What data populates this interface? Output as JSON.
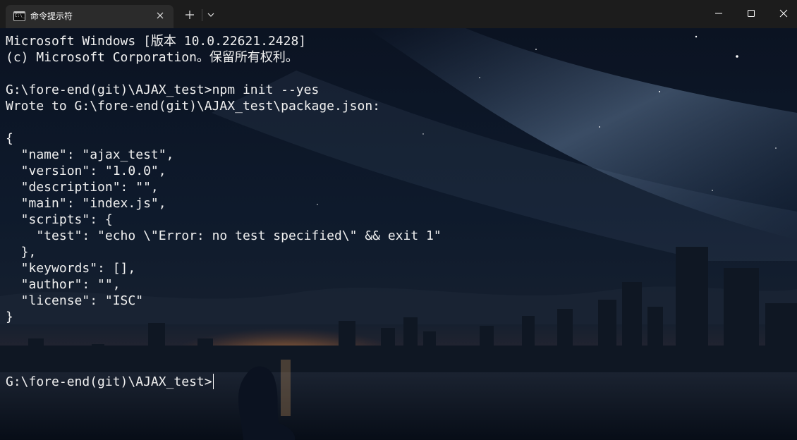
{
  "window": {
    "tab_title": "命令提示符",
    "tab_icon_text": "C:\\_",
    "icons": {
      "tab": "command-prompt-icon",
      "tab_close": "close-icon",
      "new_tab": "plus-icon",
      "dropdown": "chevron-down-icon",
      "minimize": "minimize-icon",
      "maximize": "maximize-icon",
      "close": "close-icon"
    }
  },
  "terminal": {
    "lines": [
      "Microsoft Windows [版本 10.0.22621.2428]",
      "(c) Microsoft Corporation。保留所有权利。",
      "",
      "G:\\fore-end(git)\\AJAX_test>npm init --yes",
      "Wrote to G:\\fore-end(git)\\AJAX_test\\package.json:",
      "",
      "{",
      "  \"name\": \"ajax_test\",",
      "  \"version\": \"1.0.0\",",
      "  \"description\": \"\",",
      "  \"main\": \"index.js\",",
      "  \"scripts\": {",
      "    \"test\": \"echo \\\"Error: no test specified\\\" && exit 1\"",
      "  },",
      "  \"keywords\": [],",
      "  \"author\": \"\",",
      "  \"license\": \"ISC\"",
      "}"
    ],
    "prompt": "G:\\fore-end(git)\\AJAX_test>",
    "colors": {
      "text": "#f0f0f0",
      "titlebar": "#1c1c1c",
      "tab": "#2b2b2b"
    },
    "background": "night-sky-city-skyline-wallpaper"
  }
}
